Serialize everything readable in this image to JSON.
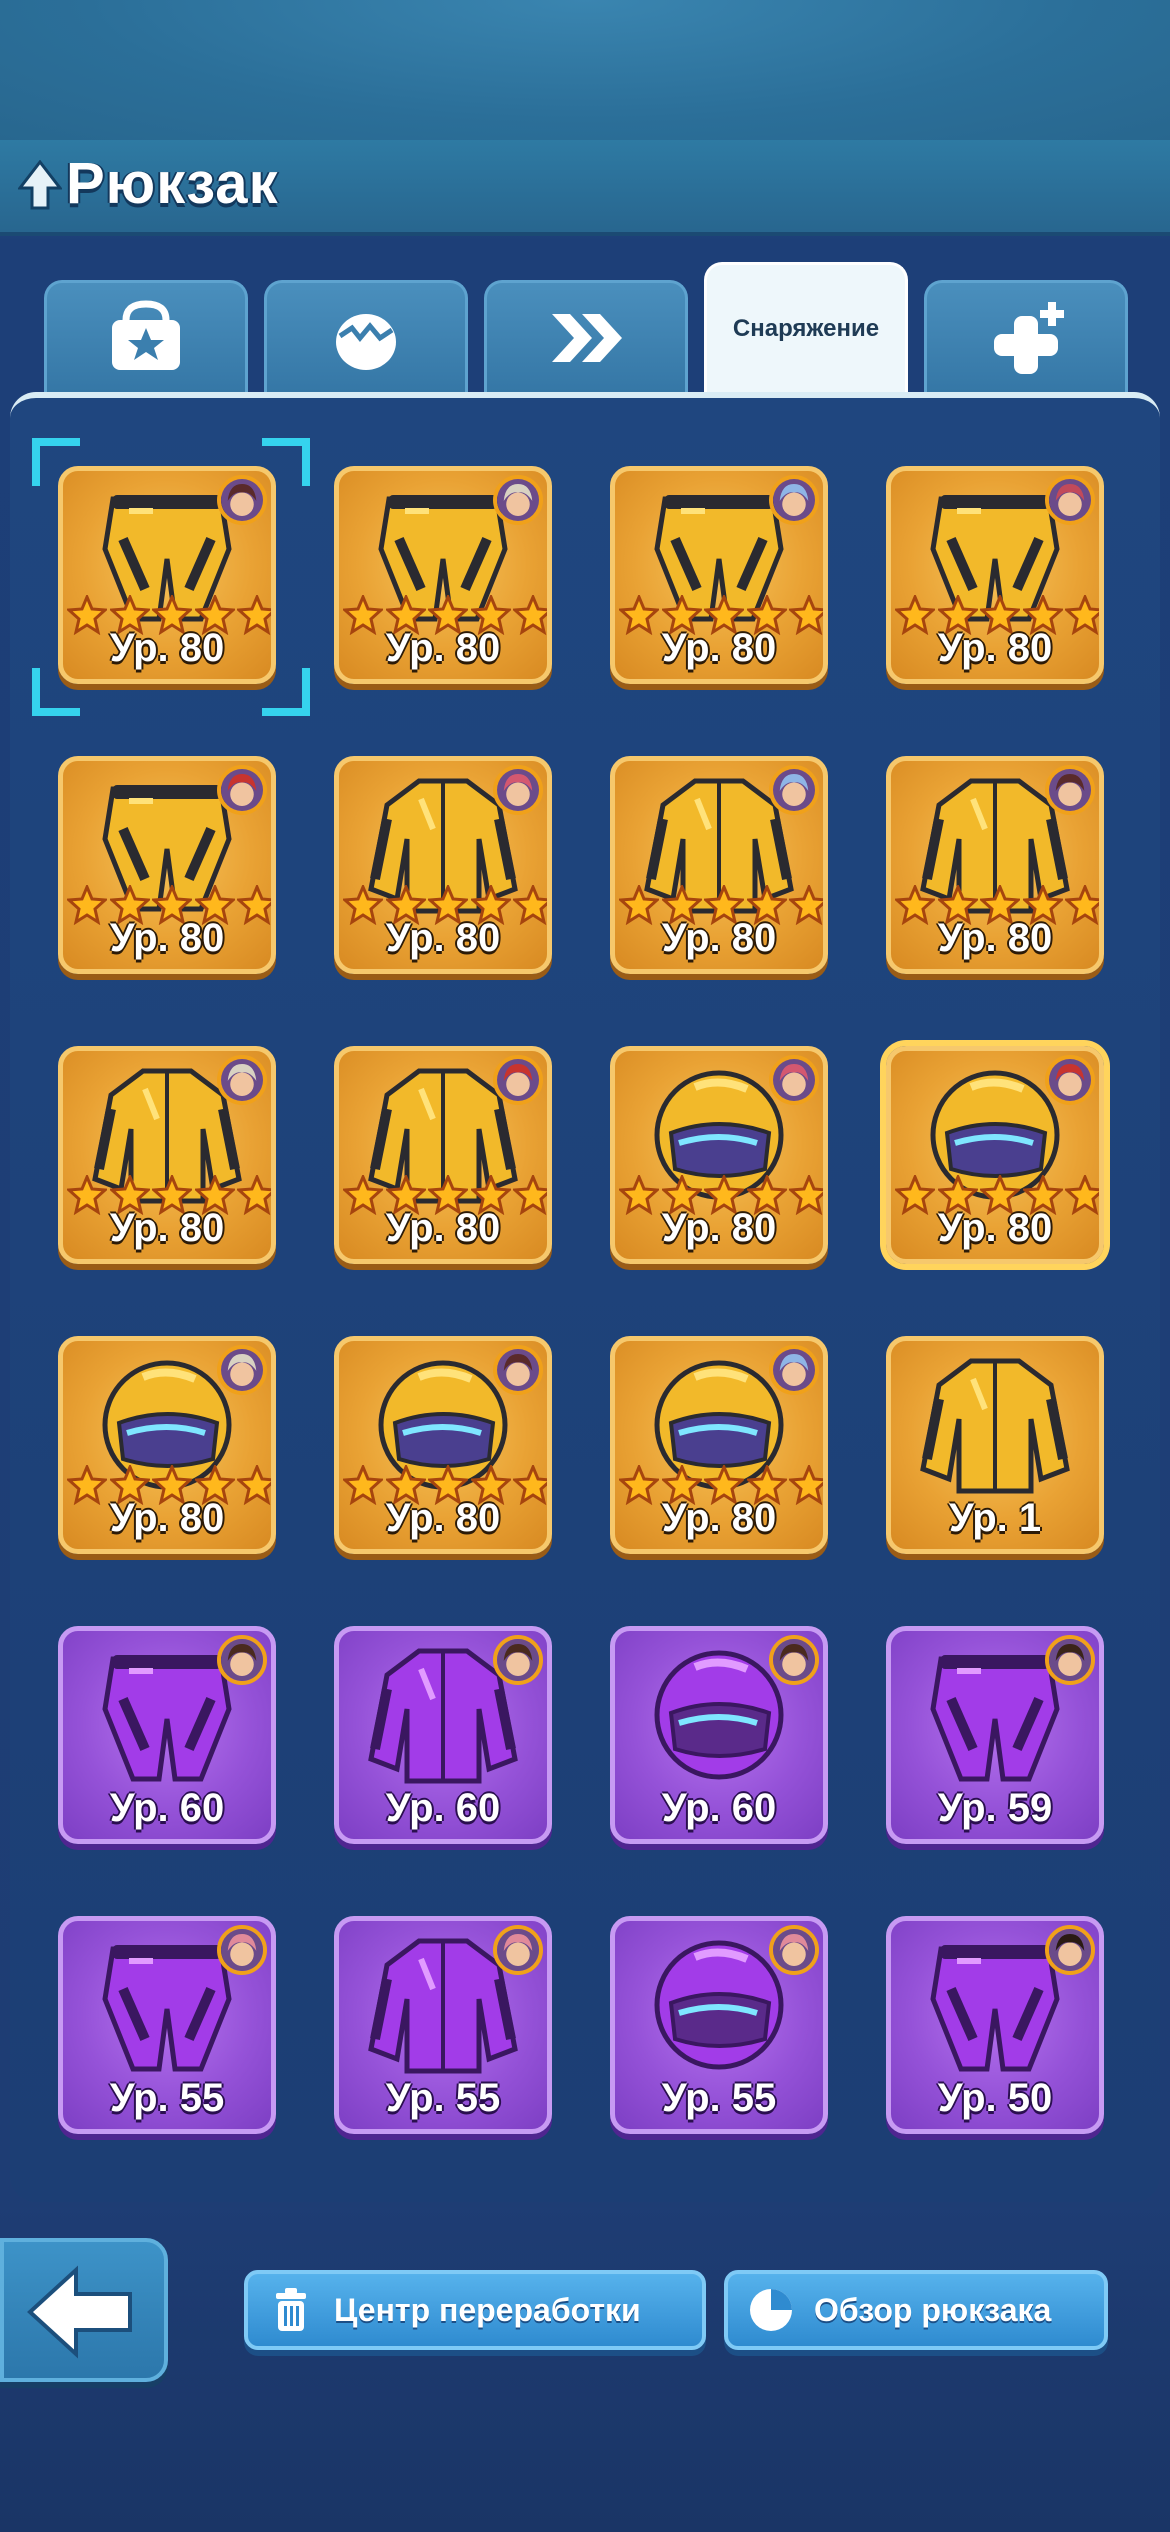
{
  "header": {
    "title": "Рюкзак",
    "title_icon": "up-arrow-tree-icon"
  },
  "tabs": [
    {
      "name": "tab-chests",
      "icon": "bag-star-icon",
      "label": ""
    },
    {
      "name": "tab-materials",
      "icon": "egg-icon",
      "label": ""
    },
    {
      "name": "tab-boosts",
      "icon": "double-chevron-icon",
      "label": ""
    },
    {
      "name": "tab-equipment",
      "icon": "",
      "label": "Снаряжение",
      "active": true
    },
    {
      "name": "tab-extra",
      "icon": "plus-icon",
      "label": ""
    }
  ],
  "items": [
    {
      "type": "pants",
      "rarity": "gold",
      "stars": 5,
      "level": "Ур. 80",
      "hair": "#5a2a2a",
      "selected": true
    },
    {
      "type": "pants",
      "rarity": "gold",
      "stars": 5,
      "level": "Ур. 80",
      "hair": "#d9d2c2"
    },
    {
      "type": "pants",
      "rarity": "gold",
      "stars": 5,
      "level": "Ур. 80",
      "hair": "#8fb5e6"
    },
    {
      "type": "pants",
      "rarity": "gold",
      "stars": 5,
      "level": "Ур. 80",
      "hair": "#c24a5a"
    },
    {
      "type": "pants",
      "rarity": "gold",
      "stars": 5,
      "level": "Ур. 80",
      "hair": "#c8342e"
    },
    {
      "type": "jacket",
      "rarity": "gold",
      "stars": 5,
      "level": "Ур. 80",
      "hair": "#d45870"
    },
    {
      "type": "jacket",
      "rarity": "gold",
      "stars": 5,
      "level": "Ур. 80",
      "hair": "#8fb5e6"
    },
    {
      "type": "jacket",
      "rarity": "gold",
      "stars": 5,
      "level": "Ур. 80",
      "hair": "#5a2a2a"
    },
    {
      "type": "jacket",
      "rarity": "gold",
      "stars": 5,
      "level": "Ур. 80",
      "hair": "#d9d2c2"
    },
    {
      "type": "jacket",
      "rarity": "gold",
      "stars": 5,
      "level": "Ур. 80",
      "hair": "#c8342e"
    },
    {
      "type": "helmet",
      "rarity": "gold",
      "stars": 5,
      "level": "Ур. 80",
      "hair": "#d45870"
    },
    {
      "type": "helmet",
      "rarity": "gold",
      "stars": 5,
      "level": "Ур. 80",
      "hair": "#c8342e",
      "glow": true
    },
    {
      "type": "helmet",
      "rarity": "gold",
      "stars": 5,
      "level": "Ур. 80",
      "hair": "#d9d2c2"
    },
    {
      "type": "helmet",
      "rarity": "gold",
      "stars": 5,
      "level": "Ур. 80",
      "hair": "#5a2a2a"
    },
    {
      "type": "helmet",
      "rarity": "gold",
      "stars": 5,
      "level": "Ур. 80",
      "hair": "#8fb5e6"
    },
    {
      "type": "jacket",
      "rarity": "gold",
      "stars": 0,
      "level": "Ур. 1",
      "hair": ""
    },
    {
      "type": "pants",
      "rarity": "purple",
      "stars": 0,
      "level": "Ур. 60",
      "hair": "#4a2a1e"
    },
    {
      "type": "jacket",
      "rarity": "purple",
      "stars": 0,
      "level": "Ур. 60",
      "hair": "#4a2a1e"
    },
    {
      "type": "helmet",
      "rarity": "purple",
      "stars": 0,
      "level": "Ур. 60",
      "hair": "#4a2a1e"
    },
    {
      "type": "pants",
      "rarity": "purple",
      "stars": 0,
      "level": "Ур. 59",
      "hair": "#3a2418"
    },
    {
      "type": "pants",
      "rarity": "purple",
      "stars": 0,
      "level": "Ур. 55",
      "hair": "#e08a9a"
    },
    {
      "type": "jacket",
      "rarity": "purple",
      "stars": 0,
      "level": "Ур. 55",
      "hair": "#e08a9a"
    },
    {
      "type": "helmet",
      "rarity": "purple",
      "stars": 0,
      "level": "Ур. 55",
      "hair": "#e08a9a"
    },
    {
      "type": "pants",
      "rarity": "purple",
      "stars": 0,
      "level": "Ур. 50",
      "hair": "#2a1a12"
    }
  ],
  "footer": {
    "back_icon": "back-arrow-icon",
    "recycle_label": "Центр переработки",
    "recycle_icon": "trash-icon",
    "overview_label": "Обзор рюкзака",
    "overview_icon": "pie-chart-icon"
  },
  "colors": {
    "gold": "#e9a234",
    "purple": "#9552d8",
    "accent": "#35d3ee",
    "star": "#ffb81c"
  }
}
